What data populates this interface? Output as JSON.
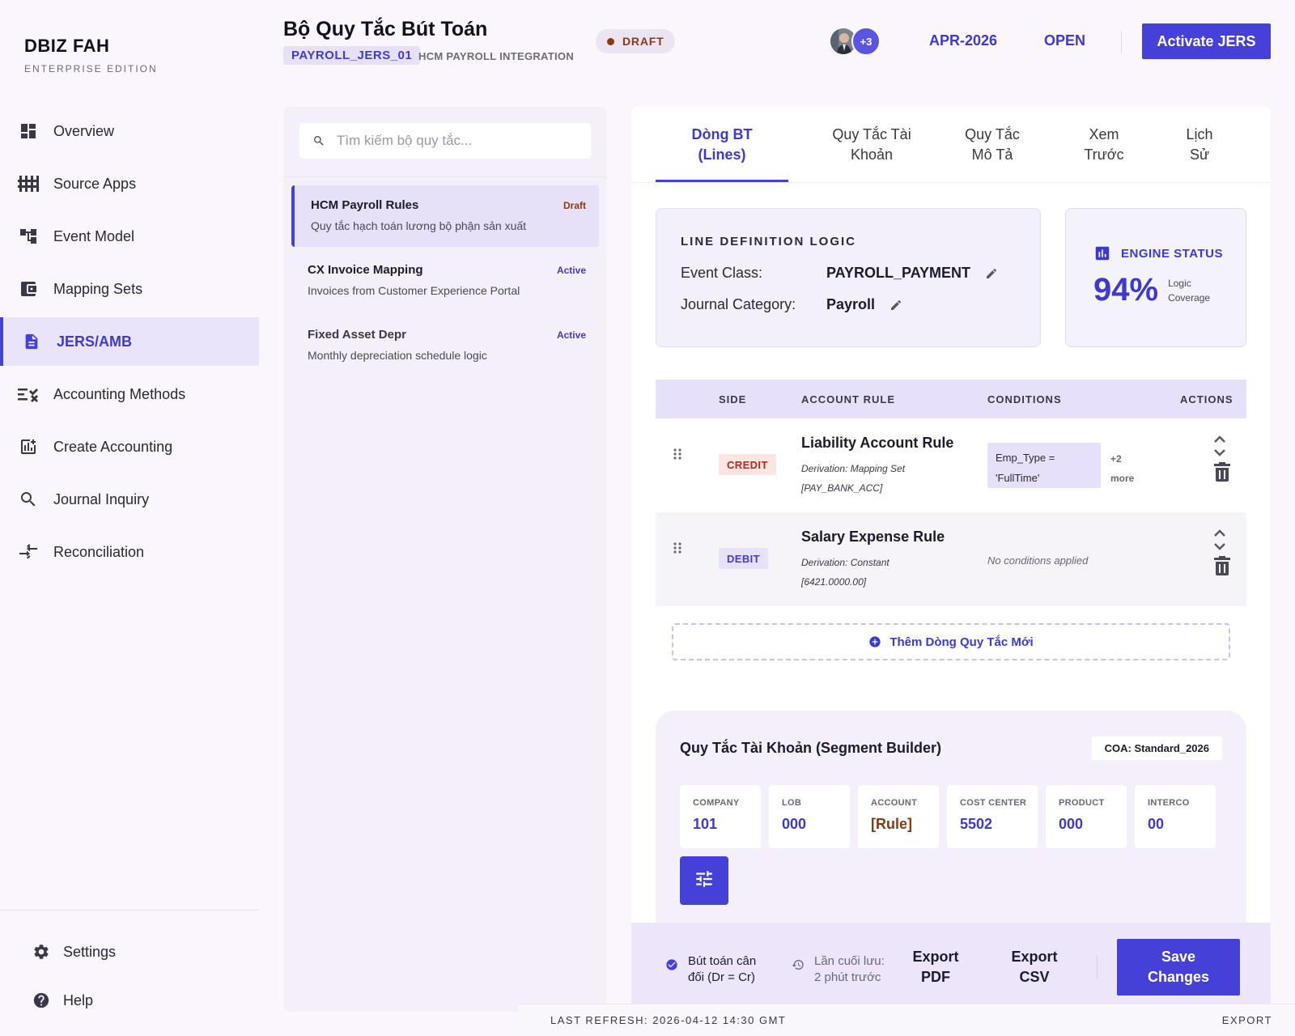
{
  "brand": {
    "name": "DBIZ FAH",
    "edition": "ENTERPRISE EDITION"
  },
  "nav": [
    {
      "label": "Overview",
      "icon": "dashboard-icon"
    },
    {
      "label": "Source Apps",
      "icon": "equalizer-icon"
    },
    {
      "label": "Event Model",
      "icon": "account-tree-icon"
    },
    {
      "label": "Mapping Sets",
      "icon": "wallet-icon"
    },
    {
      "label": "JERS/AMB",
      "icon": "description-icon"
    },
    {
      "label": "Accounting Methods",
      "icon": "rule-icon"
    },
    {
      "label": "Create Accounting",
      "icon": "add-chart-icon"
    },
    {
      "label": "Journal Inquiry",
      "icon": "search-icon"
    },
    {
      "label": "Reconciliation",
      "icon": "compare-arrows-icon"
    }
  ],
  "bottom_nav": [
    {
      "label": "Settings",
      "icon": "gear-icon"
    },
    {
      "label": "Help",
      "icon": "help-icon"
    }
  ],
  "header": {
    "title": "Bộ Quy Tắc Bút Toán",
    "code": "PAYROLL_JERS_01",
    "integration": "HCM PAYROLL INTEGRATION",
    "status": "DRAFT",
    "collaborators_more": "+3",
    "period": "APR-2026",
    "period_status": "OPEN",
    "activate_label": "Activate JERS"
  },
  "search": {
    "placeholder": "Tìm kiếm bộ quy tắc..."
  },
  "rule_sets": [
    {
      "title": "HCM Payroll Rules",
      "desc": "Quy tắc hạch toán lương bộ phận sản xuất",
      "status": "Draft"
    },
    {
      "title": "CX Invoice Mapping",
      "desc": "Invoices from Customer Experience Portal",
      "status": "Active"
    },
    {
      "title": "Fixed Asset Depr",
      "desc": "Monthly depreciation schedule logic",
      "status": "Active"
    }
  ],
  "tabs": [
    {
      "line1": "Dòng BT",
      "line2": "(Lines)"
    },
    {
      "line1": "Quy Tắc Tài",
      "line2": "Khoản"
    },
    {
      "line1": "Quy Tắc",
      "line2": "Mô Tả"
    },
    {
      "line1": "Xem",
      "line2": "Trước"
    },
    {
      "line1": "Lịch",
      "line2": "Sử"
    }
  ],
  "logic": {
    "heading": "LINE DEFINITION LOGIC",
    "event_class_label": "Event Class:",
    "event_class_value": "PAYROLL_PAYMENT",
    "journal_category_label": "Journal Category:",
    "journal_category_value": "Payroll"
  },
  "engine": {
    "title": "ENGINE STATUS",
    "percent": "94%",
    "sub_line1": "Logic",
    "sub_line2": "Coverage"
  },
  "table": {
    "headers": {
      "side": "SIDE",
      "account_rule": "ACCOUNT RULE",
      "conditions": "CONDITIONS",
      "actions": "ACTIONS"
    },
    "rows": [
      {
        "side": "CREDIT",
        "account_rule": "Liability Account Rule",
        "derivation_line1": "Derivation: Mapping Set",
        "derivation_line2": "[PAY_BANK_ACC]",
        "condition_line1": "Emp_Type =",
        "condition_line2": "'FullTime'",
        "more_line1": "+2",
        "more_line2": "more"
      },
      {
        "side": "DEBIT",
        "account_rule": "Salary Expense Rule",
        "derivation_line1": "Derivation: Constant",
        "derivation_line2": "[6421.0000.00]",
        "no_conditions": "No conditions applied"
      }
    ]
  },
  "add_line_label": "Thêm Dòng Quy Tắc Mới",
  "segment_builder": {
    "title": "Quy Tắc Tài Khoản (Segment Builder)",
    "coa": "COA: Standard_2026",
    "segments": [
      {
        "label": "COMPANY",
        "value": "101"
      },
      {
        "label": "LOB",
        "value": "000"
      },
      {
        "label": "ACCOUNT",
        "value": "[Rule]"
      },
      {
        "label": "COST CENTER",
        "value": "5502"
      },
      {
        "label": "PRODUCT",
        "value": "000"
      },
      {
        "label": "INTERCO",
        "value": "00"
      }
    ]
  },
  "footer": {
    "balance_line1": "Bút toán cân",
    "balance_line2": "đối (Dr = Cr)",
    "lastsave_line1": "Lần cuối lưu:",
    "lastsave_line2": "2 phút trước",
    "export_pdf_line1": "Export",
    "export_pdf_line2": "PDF",
    "export_csv_line1": "Export",
    "export_csv_line2": "CSV",
    "save_line1": "Save",
    "save_line2": "Changes"
  },
  "status_strip": {
    "refresh": "LAST REFRESH: 2026-04-12 14:30 GMT",
    "export": "EXPORT"
  },
  "colors": {
    "accent": "#4440d8",
    "draft": "#8a3a10",
    "credit": "#b0291e"
  }
}
